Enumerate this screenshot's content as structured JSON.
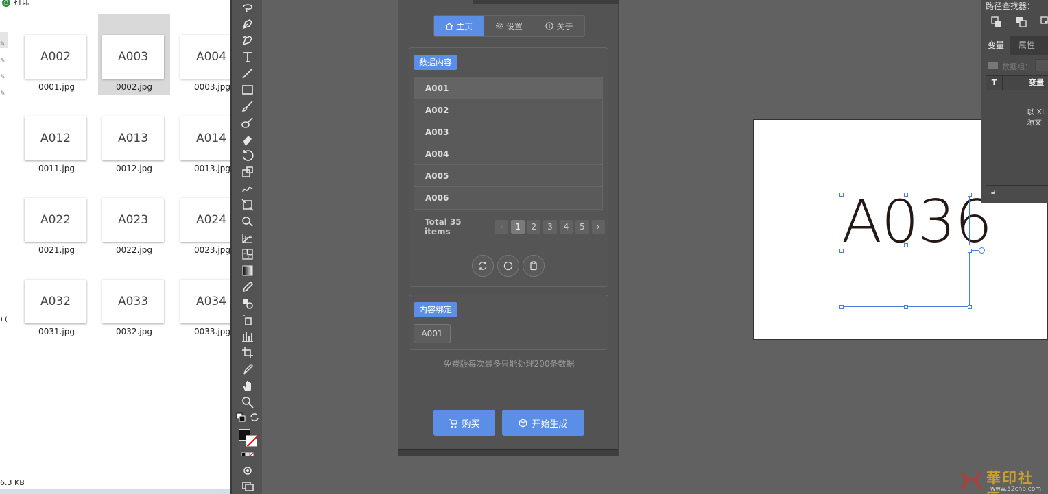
{
  "explorer": {
    "print_label": "打印",
    "stub_text": ") (",
    "status": "6.3 KB",
    "files": [
      {
        "caption": "A002",
        "name": "0001.jpg",
        "selected": false
      },
      {
        "caption": "A003",
        "name": "0002.jpg",
        "selected": true
      },
      {
        "caption": "A004",
        "name": "0003.jpg",
        "selected": false
      },
      {
        "caption": "A012",
        "name": "0011.jpg",
        "selected": false
      },
      {
        "caption": "A013",
        "name": "0012.jpg",
        "selected": false
      },
      {
        "caption": "A014",
        "name": "0013.jpg",
        "selected": false
      },
      {
        "caption": "A022",
        "name": "0021.jpg",
        "selected": false
      },
      {
        "caption": "A023",
        "name": "0022.jpg",
        "selected": false
      },
      {
        "caption": "A024",
        "name": "0023.jpg",
        "selected": false
      },
      {
        "caption": "A032",
        "name": "0031.jpg",
        "selected": false
      },
      {
        "caption": "A033",
        "name": "0032.jpg",
        "selected": false
      },
      {
        "caption": "A034",
        "name": "0033.jpg",
        "selected": false
      }
    ]
  },
  "plugin": {
    "tabs": [
      {
        "label": "主页",
        "icon": "home-icon",
        "active": true
      },
      {
        "label": "设置",
        "icon": "gear-icon",
        "active": false
      },
      {
        "label": "关于",
        "icon": "info-icon",
        "active": false
      }
    ],
    "data_section": {
      "tag": "数据内容",
      "rows": [
        "A001",
        "A002",
        "A003",
        "A004",
        "A005",
        "A006"
      ]
    },
    "pagination": {
      "total_text": "Total 35 items",
      "prev": "‹",
      "next": "›",
      "pages": [
        "1",
        "2",
        "3",
        "4",
        "5"
      ],
      "current": "1"
    },
    "bind_section": {
      "tag": "内容绑定",
      "value": "A001"
    },
    "notice": "免费版每次最多只能处理200条数据",
    "buy_label": "购买",
    "generate_label": "开始生成"
  },
  "artboard": {
    "text": "A036"
  },
  "right_panel": {
    "pathfinder_title": "路径查找器：",
    "tab_variables": "变量",
    "tab_properties": "属性",
    "dataset_label": "数据组：",
    "col_type": "T",
    "col_variable": "变量",
    "message_line1": "以 XI",
    "message_line2": "源文"
  },
  "watermark": {
    "text": "華印社區",
    "url": "www.52cnp.com"
  },
  "colors": {
    "accent": "#5b8ee6",
    "panel_bg": "#535353",
    "workspace_bg": "#616161"
  }
}
